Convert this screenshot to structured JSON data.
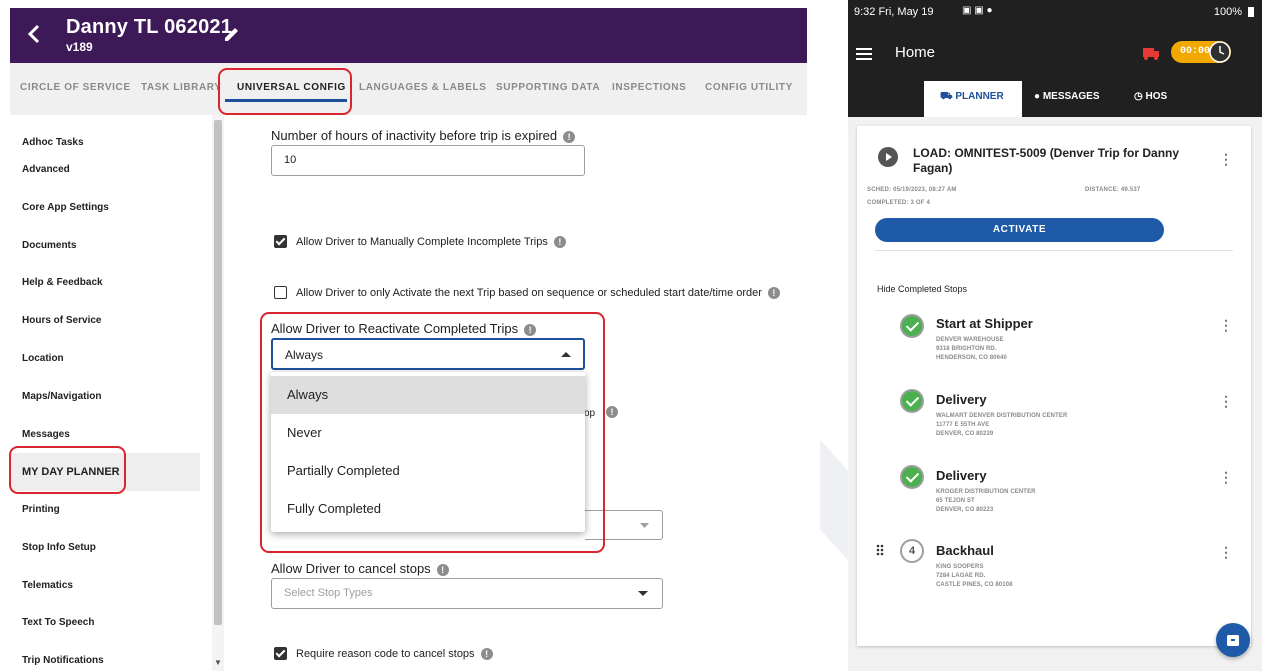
{
  "header": {
    "back_icon": "chevron-left-icon",
    "title": "Danny TL 062021",
    "version": "v189",
    "edit_icon": "pencil-icon"
  },
  "tabs": [
    "CIRCLE OF SERVICE",
    "TASK LIBRARY",
    "UNIVERSAL CONFIG",
    "LANGUAGES & LABELS",
    "SUPPORTING DATA",
    "INSPECTIONS",
    "CONFIG UTILITY"
  ],
  "sidebar": {
    "items": [
      "Adhoc Tasks",
      "Advanced",
      "Core App Settings",
      "Documents",
      "Help & Feedback",
      "Hours of Service",
      "Location",
      "Maps/Navigation",
      "Messages",
      "MY DAY PLANNER",
      "Printing",
      "Stop Info Setup",
      "Telematics",
      "Text To Speech",
      "Trip Notifications"
    ],
    "active": "MY DAY PLANNER"
  },
  "settings": {
    "inactivity_label": "Number of hours of inactivity before trip is expired",
    "inactivity_value": "10",
    "manual_complete_label": "Allow Driver to Manually Complete Incomplete Trips",
    "activate_next_label": "Allow Driver to only Activate the next Trip based on sequence or scheduled start date/time order",
    "reactivate_label": "Allow Driver to Reactivate Completed Trips",
    "reactivate_value": "Always",
    "hidden_partial": "op",
    "options": [
      "Always",
      "Never",
      "Partially Completed",
      "Fully Completed"
    ],
    "cancel_stops_label": "Allow Driver to cancel stops",
    "cancel_stops_placeholder": "Select Stop Types",
    "reason_code_label": "Require reason code to cancel stops"
  },
  "phone": {
    "status_time": "9:32  Fri, May 19",
    "status_right": "100%",
    "title": "Home",
    "timer": "00:00",
    "tabs": [
      "PLANNER",
      "MESSAGES",
      "HOS"
    ],
    "load_title": "LOAD: OMNITEST-5009 (Denver Trip for Danny Fagan)",
    "sched": "SCHED: 05/19/2023, 08:27 AM",
    "distance": "DISTANCE: 49.537",
    "completed": "COMPLETED: 3 OF 4",
    "activate": "ACTIVATE",
    "hide_completed": "Hide Completed Stops",
    "stops": [
      {
        "title": "Start at Shipper",
        "l1": "DENVER WAREHOUSE",
        "l2": "9318 BRIGHTON RD.",
        "l3": "HENDERSON, CO 80640"
      },
      {
        "title": "Delivery",
        "l1": "WALMART DENVER DISTRIBUTION CENTER",
        "l2": "11777 E 55TH AVE",
        "l3": "DENVER, CO 80239"
      },
      {
        "title": "Delivery",
        "l1": "KROGER DISTRIBUTION CENTER",
        "l2": "65 TEJON ST",
        "l3": "DENVER, CO 80223"
      },
      {
        "title": "Backhaul",
        "num": "4",
        "l1": "KING SOOPERS",
        "l2": "7284 LAGAE RD.",
        "l3": "CASTLE PINES, CO 80108"
      }
    ]
  }
}
